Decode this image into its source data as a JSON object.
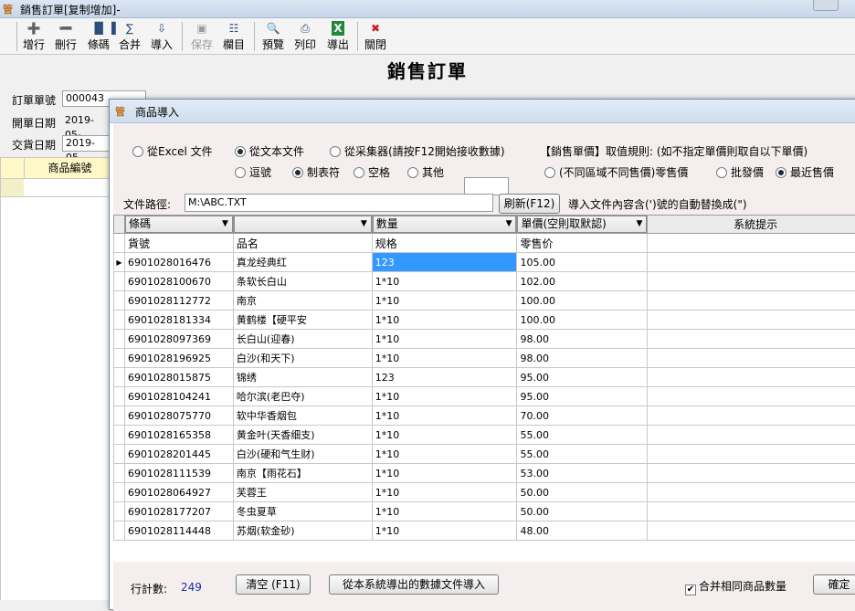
{
  "main": {
    "title": "銷售訂單[复制增加]-",
    "app_icon": "app-logo-icon",
    "toolbar": [
      {
        "label": "增行",
        "icon": "add-row-icon",
        "enabled": true
      },
      {
        "label": "刪行",
        "icon": "delete-row-icon",
        "enabled": true
      },
      {
        "label": "條碼",
        "icon": "barcode-icon",
        "enabled": true
      },
      {
        "label": "合并",
        "icon": "merge-icon",
        "enabled": true
      },
      {
        "label": "導入",
        "icon": "import-icon",
        "enabled": true
      },
      {
        "label": "保存",
        "icon": "save-icon",
        "enabled": false
      },
      {
        "label": "欄目",
        "icon": "columns-icon",
        "enabled": true
      },
      {
        "label": "預覽",
        "icon": "preview-icon",
        "enabled": true
      },
      {
        "label": "列印",
        "icon": "print-icon",
        "enabled": true
      },
      {
        "label": "導出",
        "icon": "excel-export-icon",
        "enabled": true
      },
      {
        "label": "關閉",
        "icon": "close-icon",
        "enabled": true
      }
    ],
    "form_title": "銷售訂單",
    "fields": {
      "order_no_label": "訂單單號",
      "order_no_value": "000043",
      "open_date_label": "開單日期",
      "open_date_value": "2019-05-",
      "delivery_date_label": "交貨日期",
      "delivery_date_value": "2019-05-"
    },
    "grid_header": "商品編號"
  },
  "dialog": {
    "title": "商品導入",
    "source_options": [
      {
        "label": "從Excel 文件",
        "selected": false
      },
      {
        "label": "從文本文件",
        "selected": true
      },
      {
        "label": "從采集器(請按F12開始接收數據)",
        "selected": false
      }
    ],
    "delimiter_options": [
      {
        "label": "逗號",
        "selected": false
      },
      {
        "label": "制表符",
        "selected": true
      },
      {
        "label": "空格",
        "selected": false
      },
      {
        "label": "其他",
        "selected": false
      }
    ],
    "price_rule_label": "【銷售單價】取值規則: (如不指定單價則取自以下單價)",
    "price_options": [
      {
        "label": "(不同區域不同售價)零售價",
        "selected": false
      },
      {
        "label": "批發價",
        "selected": false
      },
      {
        "label": "最近售價",
        "selected": true
      }
    ],
    "path_label": "文件路徑:",
    "path_value": "M:\\ABC.TXT",
    "refresh_button": "刷新(F12)",
    "replace_note": "導入文件內容含(')號的自動替換成(\")",
    "column_mapping": [
      "條碼",
      "",
      "數量",
      "單價(空則取默認)"
    ],
    "system_hint_header": "系統提示",
    "rows": [
      [
        "貨號",
        "品名",
        "规格",
        "零售价"
      ],
      [
        "6901028016476",
        "真龙经典红",
        "123",
        "105.00"
      ],
      [
        "6901028100670",
        "条软长白山",
        "1*10",
        "102.00"
      ],
      [
        "6901028112772",
        "南京",
        "1*10",
        "100.00"
      ],
      [
        "6901028181334",
        "黄鹤楼【硬平安",
        "1*10",
        "100.00"
      ],
      [
        "6901028097369",
        "长白山(迎春)",
        "1*10",
        "98.00"
      ],
      [
        "6901028196925",
        "白沙(和天下)",
        "1*10",
        "98.00"
      ],
      [
        "6901028015875",
        "锦绣",
        "123",
        "95.00"
      ],
      [
        "6901028104241",
        "哈尔滨(老巴夺)",
        "1*10",
        "95.00"
      ],
      [
        "6901028075770",
        "软中华香烟包",
        "1*10",
        "70.00"
      ],
      [
        "6901028165358",
        "黄金叶(天香细支)",
        "1*10",
        "55.00"
      ],
      [
        "6901028201445",
        "白沙(硬和气生财)",
        "1*10",
        "55.00"
      ],
      [
        "6901028111539",
        "南京【雨花石】",
        "1*10",
        "53.00"
      ],
      [
        "6901028064927",
        "芙蓉王",
        "1*10",
        "50.00"
      ],
      [
        "6901028177207",
        "冬虫夏草",
        "1*10",
        "50.00"
      ],
      [
        "6901028114448",
        "苏烟(软金砂)",
        "1*10",
        "48.00"
      ]
    ],
    "selected_row": 1,
    "selected_col": 2,
    "count_label": "行計數:",
    "count_value": "249",
    "clear_button": "清空 (F11)",
    "import_system_button": "從本系統導出的數據文件導入",
    "merge_checkbox_label": "合并相同商品數量",
    "merge_checked": true,
    "confirm_button": "確定"
  }
}
